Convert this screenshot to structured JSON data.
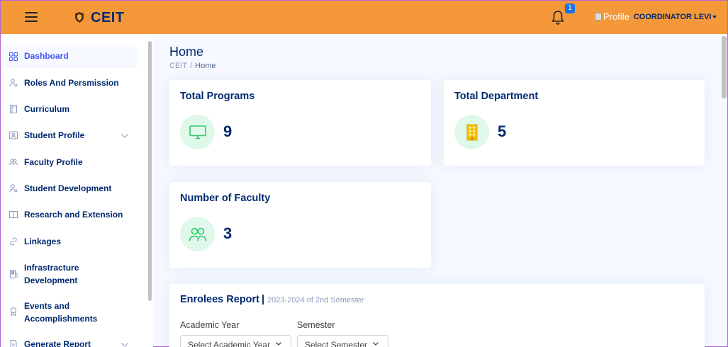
{
  "header": {
    "brand": "CEIT",
    "notification_count": "1",
    "profile_alt": "Profile",
    "user_name": "COORDINATOR LEVI"
  },
  "sidebar": {
    "items": [
      {
        "label": "Dashboard",
        "icon": "grid-icon",
        "active": true
      },
      {
        "label": "Roles And Persmission",
        "icon": "person-gear-icon"
      },
      {
        "label": "Curriculum",
        "icon": "journal-icon"
      },
      {
        "label": "Student Profile",
        "icon": "person-badge-icon",
        "has_children": true
      },
      {
        "label": "Faculty Profile",
        "icon": "people-icon"
      },
      {
        "label": "Student Development",
        "icon": "person-gear-icon"
      },
      {
        "label": "Research and Extension",
        "icon": "book-icon"
      },
      {
        "label": "Linkages",
        "icon": "link-icon"
      },
      {
        "label": "Infrastracture Development",
        "label_line1": "Infrastracture",
        "label_line2": "Development",
        "icon": "building-icon"
      },
      {
        "label": "Events and Accomplishments",
        "label_line1": "Events and",
        "label_line2": "Accomplishments",
        "icon": "award-icon"
      },
      {
        "label": "Generate Report",
        "icon": "file-icon",
        "has_children": true
      }
    ]
  },
  "page": {
    "title": "Home",
    "breadcrumb": [
      "CEIT",
      "Home"
    ],
    "breadcrumb_sep": "/"
  },
  "cards": {
    "programs": {
      "title": "Total Programs",
      "value": "9",
      "icon": "monitor-icon",
      "color": "#2eca6a"
    },
    "departments": {
      "title": "Total Department",
      "value": "5",
      "icon": "building-icon",
      "color": "#f4c20d"
    },
    "faculty": {
      "title": "Number of Faculty",
      "value": "3",
      "icon": "people-icon",
      "color": "#2eca6a"
    }
  },
  "report": {
    "title": "Enrolees Report",
    "separator": "|",
    "subtitle": "2023-2024 of 2nd Semester",
    "year_label": "Academic Year",
    "year_placeholder": "Select Academic Year",
    "semester_label": "Semester",
    "semester_placeholder": "Select Semester"
  },
  "colors": {
    "topbar": "#f4983a",
    "navy": "#012970",
    "accent": "#4154f1",
    "page_bg": "#f6f9ff"
  }
}
